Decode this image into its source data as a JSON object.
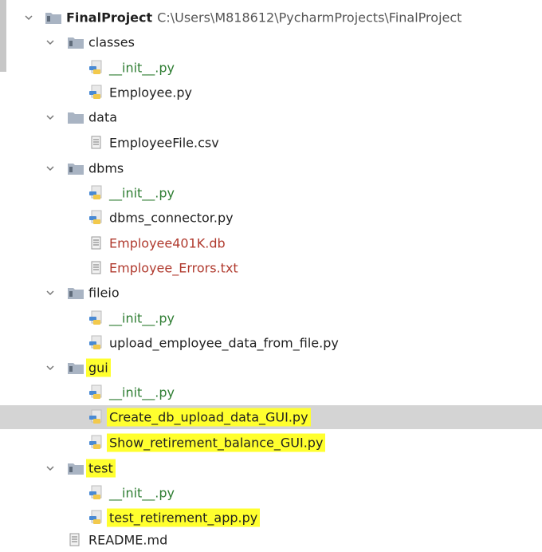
{
  "project": {
    "name": "FinalProject",
    "path": "C:\\Users\\M818612\\PycharmProjects\\FinalProject"
  },
  "folders": {
    "classes": "classes",
    "data": "data",
    "dbms": "dbms",
    "fileio": "fileio",
    "gui": "gui",
    "test": "test"
  },
  "files": {
    "classes_init": "__init__.py",
    "employee_py": "Employee.py",
    "employee_csv": "EmployeeFile.csv",
    "dbms_init": "__init__.py",
    "dbms_connector": "dbms_connector.py",
    "employee_db": "Employee401K.db",
    "employee_errors": "Employee_Errors.txt",
    "fileio_init": "__init__.py",
    "upload_employee": "upload_employee_data_from_file.py",
    "gui_init": "__init__.py",
    "create_db_gui": "Create_db_upload_data_GUI.py",
    "show_retirement_gui": "Show_retirement_balance_GUI.py",
    "test_init": "__init__.py",
    "test_retirement": "test_retirement_app.py",
    "readme": "README.md"
  },
  "icons": {
    "chevron": "chevron-down-icon",
    "folder": "folder-icon",
    "python_file": "python-file-icon",
    "text_file": "text-file-icon"
  },
  "colors": {
    "highlight": "#ffff2e",
    "selected_row": "#d4d4d4",
    "green_text": "#2e7d32",
    "red_text": "#b03a2e"
  }
}
